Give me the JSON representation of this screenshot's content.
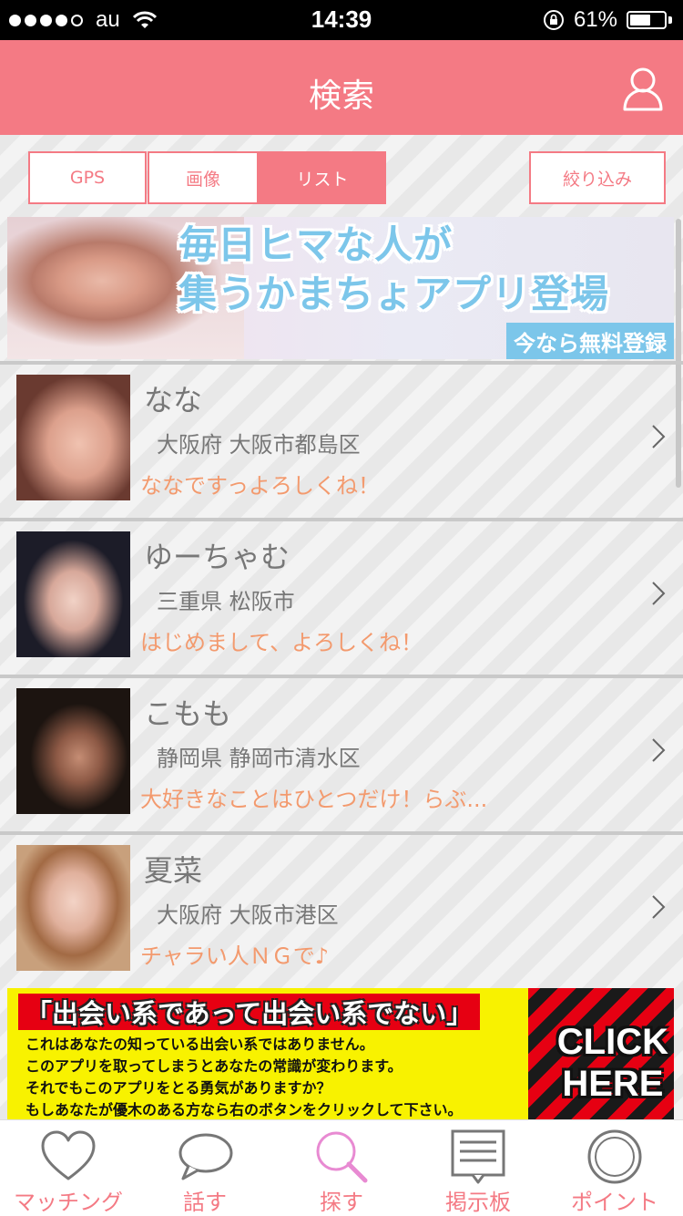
{
  "status_bar": {
    "carrier": "au",
    "time": "14:39",
    "battery": "61%",
    "battery_level": 0.61
  },
  "header": {
    "title": "検索",
    "profile_icon": "person-outline-icon"
  },
  "segments": {
    "gps": "GPS",
    "image": "画像",
    "list": "リスト",
    "selected": "リスト"
  },
  "filter_label": "絞り込み",
  "banner_top": {
    "line1": "毎日ヒマな人が",
    "line2": "集うかまちょアプリ登場",
    "tag": "今なら無料登録"
  },
  "users": [
    {
      "name": "なな",
      "location": "大阪府 大阪市都島区",
      "message": "ななですっよろしくね！"
    },
    {
      "name": "ゆーちゃむ",
      "location": "三重県 松阪市",
      "message": "はじめまして、よろしくね！"
    },
    {
      "name": "こもも",
      "location": "静岡県 静岡市清水区",
      "message": "大好きなことはひとつだけ！らぶ..."
    },
    {
      "name": "夏菜",
      "location": "大阪府 大阪市港区",
      "message": "チャラい人ＮＧで♪"
    }
  ],
  "banner_bottom": {
    "title": "「出会い系であって出会い系でない」",
    "lines": [
      "これはあなたの知っている出会い系ではありません。",
      "このアプリを取ってしまうとあなたの常識が変わります。",
      "それでもこのアプリをとる勇気がありますか？",
      "もしあなたが優木のある方なら右のボタンをクリックして下さい。"
    ],
    "click_line1": "CLICK",
    "click_line2": "HERE"
  },
  "tabs": [
    {
      "label": "マッチング",
      "icon": "heart-icon"
    },
    {
      "label": "話す",
      "icon": "speech-bubble-icon"
    },
    {
      "label": "探す",
      "icon": "search-icon",
      "active": true
    },
    {
      "label": "掲示板",
      "icon": "board-icon"
    },
    {
      "label": "ポイント",
      "icon": "coin-icon"
    }
  ],
  "colors": {
    "accent": "#f47a84",
    "message": "#f39a6e",
    "banner_blue": "#7cc6ea",
    "banner_yellow": "#f8f200",
    "search_active": "#e88ad2"
  }
}
